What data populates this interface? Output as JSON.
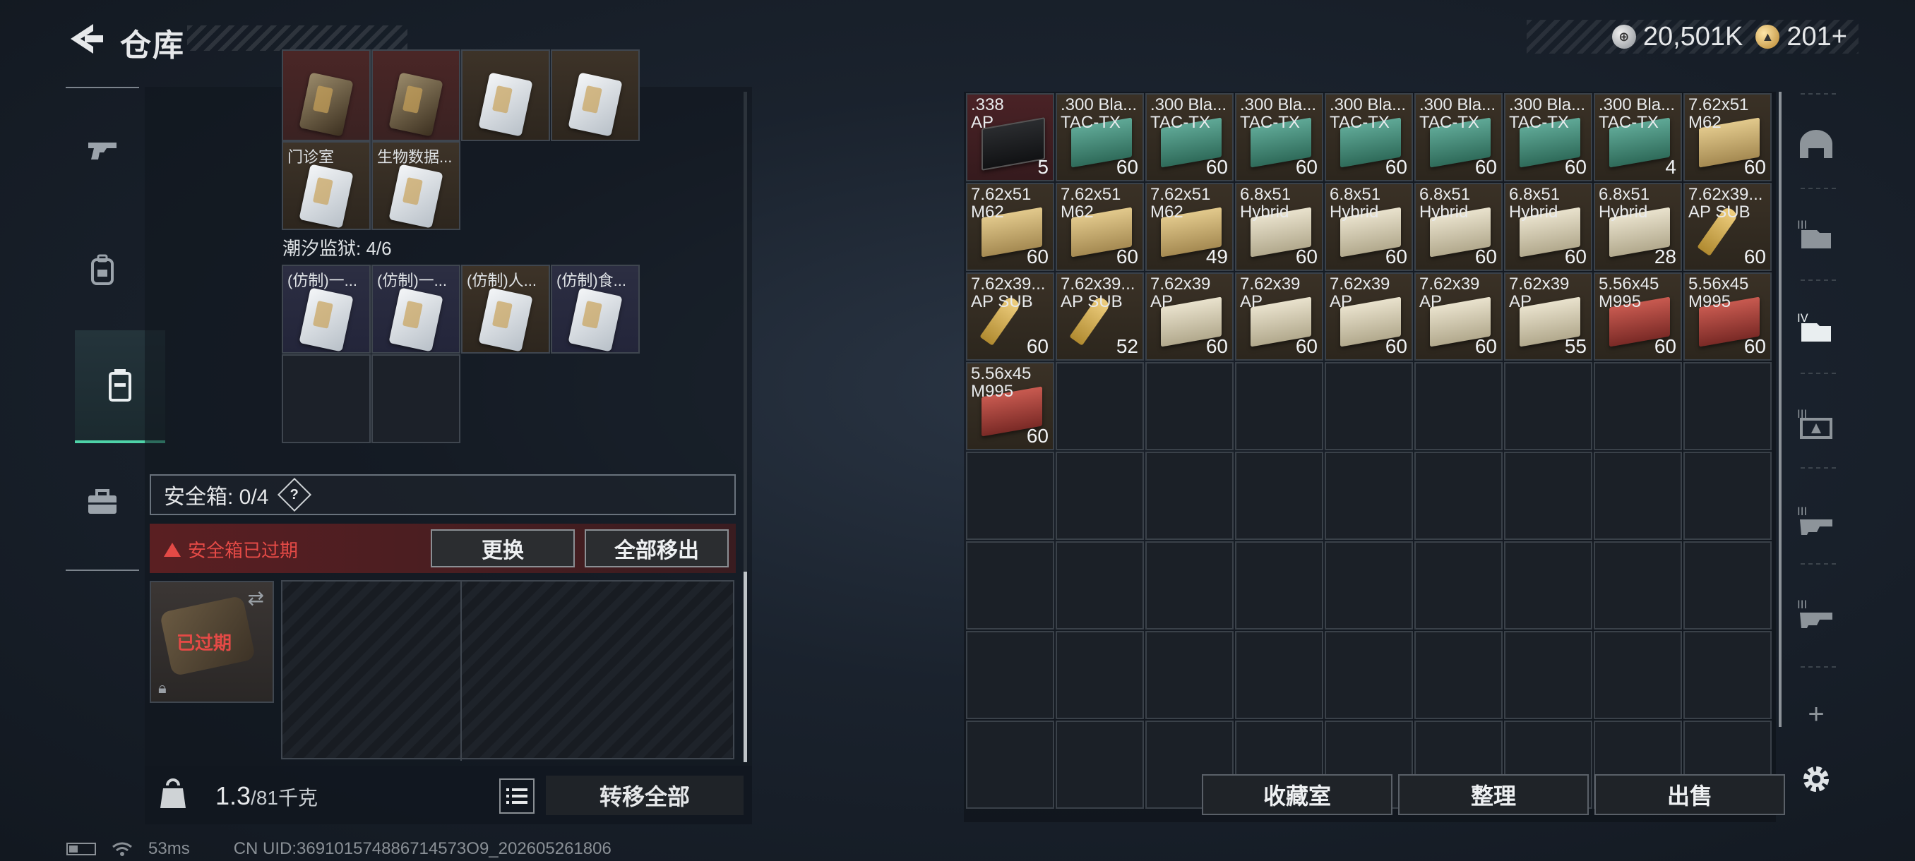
{
  "header": {
    "title": "仓库",
    "currency_silver": "20,501K",
    "currency_gold": "201+"
  },
  "left_rail": {
    "items": [
      {
        "icon": "gun-icon"
      },
      {
        "icon": "backpack-icon"
      },
      {
        "icon": "container-icon",
        "active": true
      },
      {
        "icon": "briefcase-icon"
      }
    ]
  },
  "storage": {
    "top_row_labels": [
      "",
      "",
      "",
      ""
    ],
    "row2_labels": [
      "门诊室",
      "生物数据..."
    ],
    "section_title": "潮汐监狱: 4/6",
    "section_items": [
      "(仿制)一...",
      "(仿制)一...",
      "(仿制)人...",
      "(仿制)食..."
    ],
    "safebox_label": "安全箱: 0/4",
    "safebox_help": "?",
    "expired_warning": "安全箱已过期",
    "replace_button": "更换",
    "move_all_button": "全部移出",
    "case_expired": "已过期",
    "weight_value": "1.3",
    "weight_max": "/81千克",
    "transfer_all_button": "转移全部"
  },
  "right_grid": {
    "items": [
      {
        "name": ".338\nAP",
        "qty": "5",
        "box": "black",
        "bg": "red"
      },
      {
        "name": ".300 Bla...\nTAC-TX",
        "qty": "60",
        "box": "green"
      },
      {
        "name": ".300 Bla...\nTAC-TX",
        "qty": "60",
        "box": "green"
      },
      {
        "name": ".300 Bla...\nTAC-TX",
        "qty": "60",
        "box": "green"
      },
      {
        "name": ".300 Bla...\nTAC-TX",
        "qty": "60",
        "box": "green"
      },
      {
        "name": ".300 Bla...\nTAC-TX",
        "qty": "60",
        "box": "green"
      },
      {
        "name": ".300 Bla...\nTAC-TX",
        "qty": "60",
        "box": "green"
      },
      {
        "name": ".300 Bla...\nTAC-TX",
        "qty": "4",
        "box": "green"
      },
      {
        "name": "7.62x51\nM62",
        "qty": "60",
        "box": "tan"
      },
      {
        "name": "7.62x51\nM62",
        "qty": "60",
        "box": "tan"
      },
      {
        "name": "7.62x51\nM62",
        "qty": "60",
        "box": "tan"
      },
      {
        "name": "7.62x51\nM62",
        "qty": "49",
        "box": "tan"
      },
      {
        "name": "6.8x51\nHybrid",
        "qty": "60",
        "box": "cream"
      },
      {
        "name": "6.8x51\nHybrid",
        "qty": "60",
        "box": "cream"
      },
      {
        "name": "6.8x51\nHybrid",
        "qty": "60",
        "box": "cream"
      },
      {
        "name": "6.8x51\nHybrid",
        "qty": "60",
        "box": "cream"
      },
      {
        "name": "6.8x51\nHybrid",
        "qty": "28",
        "box": "cream"
      },
      {
        "name": "7.62x39...\nAP SUB",
        "qty": "60",
        "box": "bullet"
      },
      {
        "name": "7.62x39...\nAP SUB",
        "qty": "60",
        "box": "bullet"
      },
      {
        "name": "7.62x39...\nAP SUB",
        "qty": "52",
        "box": "bullet"
      },
      {
        "name": "7.62x39\nAP",
        "qty": "60",
        "box": "cream"
      },
      {
        "name": "7.62x39\nAP",
        "qty": "60",
        "box": "cream"
      },
      {
        "name": "7.62x39\nAP",
        "qty": "60",
        "box": "cream"
      },
      {
        "name": "7.62x39\nAP",
        "qty": "60",
        "box": "cream"
      },
      {
        "name": "7.62x39\nAP",
        "qty": "55",
        "box": "cream"
      },
      {
        "name": "5.56x45\nM995",
        "qty": "60",
        "box": "redb"
      },
      {
        "name": "5.56x45\nM995",
        "qty": "60",
        "box": "redb"
      },
      {
        "name": "5.56x45\nM995",
        "qty": "60",
        "box": "redb"
      }
    ],
    "buttons": {
      "collection": "收藏室",
      "organize": "整理",
      "sell": "出售"
    }
  },
  "right_rail": {
    "items": [
      "helmet-icon",
      "folder-3-icon",
      "folder-4-icon",
      "folder-5-icon",
      "folder-6-icon",
      "folder-7-icon"
    ],
    "add_label": "+"
  },
  "status_bar": {
    "ping": "53ms",
    "uid": "CN UID:369101574886714573O9_202605261806"
  },
  "colors": {
    "accent_green": "#4ed3a8",
    "warning_red": "#e44a46"
  }
}
